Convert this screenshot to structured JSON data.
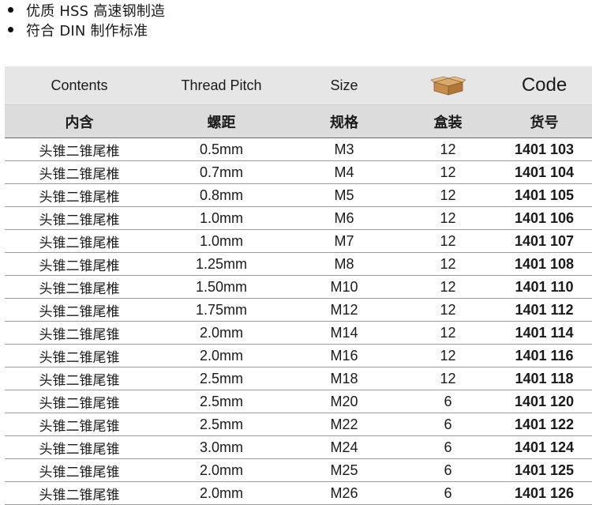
{
  "bullets": [
    "优质 HSS 高速钢制造",
    "符合 DIN 制作标准"
  ],
  "table": {
    "headers_en": {
      "contents": "Contents",
      "pitch": "Thread Pitch",
      "size": "Size",
      "code": "Code"
    },
    "headers_cn": {
      "contents": "内含",
      "pitch": "螺距",
      "size": "规格",
      "box": "盒装",
      "code": "货号"
    },
    "box_icon": "cardboard-box-icon",
    "rows": [
      {
        "contents": "头锥二锥尾椎",
        "pitch": "0.5mm",
        "size": "M3",
        "box": "12",
        "code": "1401 103"
      },
      {
        "contents": "头锥二锥尾椎",
        "pitch": "0.7mm",
        "size": "M4",
        "box": "12",
        "code": "1401 104"
      },
      {
        "contents": "头锥二锥尾椎",
        "pitch": "0.8mm",
        "size": "M5",
        "box": "12",
        "code": "1401 105"
      },
      {
        "contents": "头锥二锥尾椎",
        "pitch": "1.0mm",
        "size": "M6",
        "box": "12",
        "code": "1401 106"
      },
      {
        "contents": "头锥二锥尾椎",
        "pitch": "1.0mm",
        "size": "M7",
        "box": "12",
        "code": "1401 107"
      },
      {
        "contents": "头锥二锥尾椎",
        "pitch": "1.25mm",
        "size": "M8",
        "box": "12",
        "code": "1401 108"
      },
      {
        "contents": "头锥二锥尾椎",
        "pitch": "1.50mm",
        "size": "M10",
        "box": "12",
        "code": "1401 110"
      },
      {
        "contents": "头锥二锥尾椎",
        "pitch": "1.75mm",
        "size": "M12",
        "box": "12",
        "code": "1401 112"
      },
      {
        "contents": "头锥二锥尾锥",
        "pitch": "2.0mm",
        "size": "M14",
        "box": "12",
        "code": "1401 114"
      },
      {
        "contents": "头锥二锥尾锥",
        "pitch": "2.0mm",
        "size": "M16",
        "box": "12",
        "code": "1401 116"
      },
      {
        "contents": "头锥二锥尾锥",
        "pitch": "2.5mm",
        "size": "M18",
        "box": "12",
        "code": "1401 118"
      },
      {
        "contents": "头锥二锥尾锥",
        "pitch": "2.5mm",
        "size": "M20",
        "box": "6",
        "code": "1401 120"
      },
      {
        "contents": "头锥二锥尾锥",
        "pitch": "2.5mm",
        "size": "M22",
        "box": "6",
        "code": "1401 122"
      },
      {
        "contents": "头锥二锥尾锥",
        "pitch": "3.0mm",
        "size": "M24",
        "box": "6",
        "code": "1401 124"
      },
      {
        "contents": "头锥二锥尾锥",
        "pitch": "2.0mm",
        "size": "M25",
        "box": "6",
        "code": "1401 125"
      },
      {
        "contents": "头锥二锥尾锥",
        "pitch": "2.0mm",
        "size": "M26",
        "box": "6",
        "code": "1401 126"
      }
    ]
  }
}
